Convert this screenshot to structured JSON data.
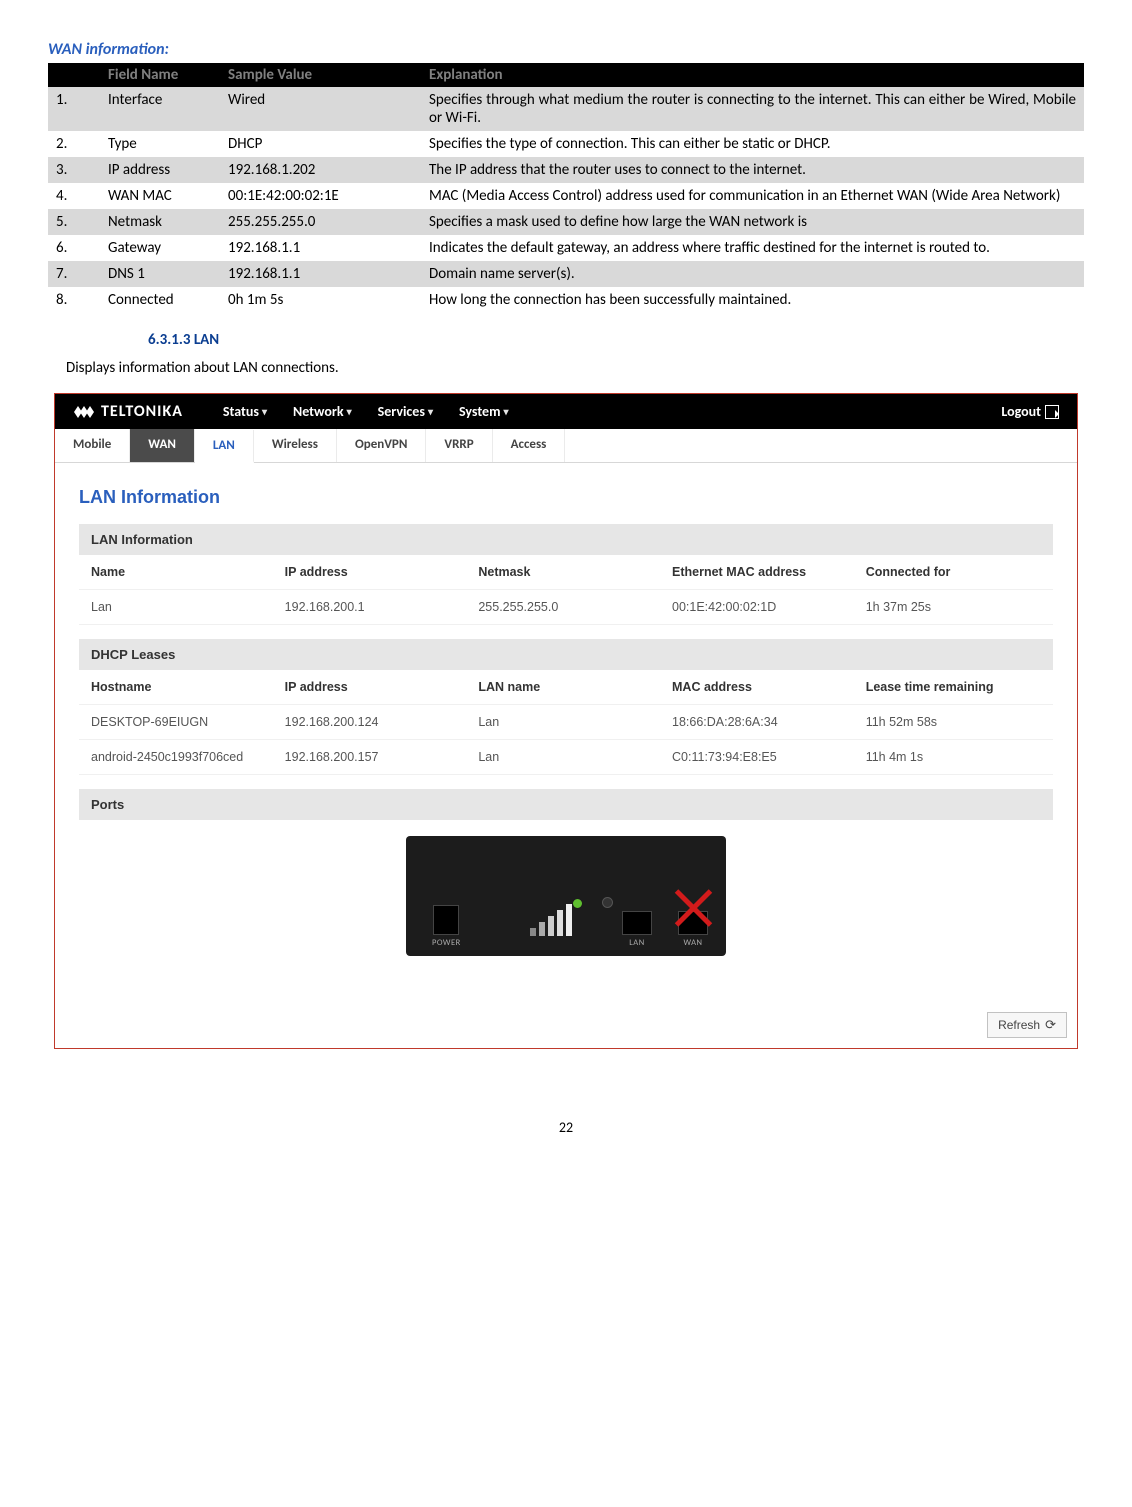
{
  "section_title": "WAN information:",
  "wan_table": {
    "headers": [
      "",
      "Field Name",
      "Sample Value",
      "Explanation"
    ],
    "rows": [
      {
        "num": "1.",
        "field": "Interface",
        "sample": "Wired",
        "expl": "Specifies through what medium the router is connecting to the internet. This can either be Wired, Mobile or Wi-Fi."
      },
      {
        "num": "2.",
        "field": "Type",
        "sample": "DHCP",
        "expl": "Specifies the type of connection. This can either be static or DHCP."
      },
      {
        "num": "3.",
        "field": "IP address",
        "sample": "192.168.1.202",
        "expl": "The IP address that the router uses to connect to the internet."
      },
      {
        "num": "4.",
        "field": "WAN MAC",
        "sample": "00:1E:42:00:02:1E",
        "expl": "MAC (Media Access Control) address used for communication in an Ethernet WAN (Wide Area Network)"
      },
      {
        "num": "5.",
        "field": "Netmask",
        "sample": "255.255.255.0",
        "expl": "Specifies a mask used to define how large the WAN network is"
      },
      {
        "num": "6.",
        "field": "Gateway",
        "sample": "192.168.1.1",
        "expl": "Indicates the default gateway, an address where traffic destined for the internet is routed to."
      },
      {
        "num": "7.",
        "field": "DNS 1",
        "sample": "192.168.1.1",
        "expl": "Domain name server(s)."
      },
      {
        "num": "8.",
        "field": "Connected",
        "sample": "0h 1m 5s",
        "expl": "How long the connection has been successfully maintained."
      }
    ]
  },
  "sub_heading": "6.3.1.3    LAN",
  "body_text": "Displays information about LAN connections.",
  "ui": {
    "logo_text": "TELTONIKA",
    "nav": [
      "Status",
      "Network",
      "Services",
      "System"
    ],
    "logout": "Logout",
    "tabs": [
      "Mobile",
      "WAN",
      "LAN",
      "Wireless",
      "OpenVPN",
      "VRRP",
      "Access"
    ],
    "active_tab_index": 2,
    "page_title": "LAN Information",
    "lan_info": {
      "section_label": "LAN Information",
      "columns": [
        "Name",
        "IP address",
        "Netmask",
        "Ethernet MAC address",
        "Connected for"
      ],
      "rows": [
        {
          "c0": "Lan",
          "c1": "192.168.200.1",
          "c2": "255.255.255.0",
          "c3": "00:1E:42:00:02:1D",
          "c4": "1h 37m 25s"
        }
      ]
    },
    "dhcp": {
      "section_label": "DHCP Leases",
      "columns": [
        "Hostname",
        "IP address",
        "LAN name",
        "MAC address",
        "Lease time remaining"
      ],
      "rows": [
        {
          "c0": "DESKTOP-69EIUGN",
          "c1": "192.168.200.124",
          "c2": "Lan",
          "c3": "18:66:DA:28:6A:34",
          "c4": "11h 52m 58s"
        },
        {
          "c0": "android-2450c1993f706ced",
          "c1": "192.168.200.157",
          "c2": "Lan",
          "c3": "C0:11:73:94:E8:E5",
          "c4": "11h 4m 1s"
        }
      ]
    },
    "ports_label": "Ports",
    "port_labels": {
      "power": "POWER",
      "lan": "LAN",
      "wan": "WAN"
    },
    "refresh_label": "Refresh"
  },
  "page_number": "22"
}
